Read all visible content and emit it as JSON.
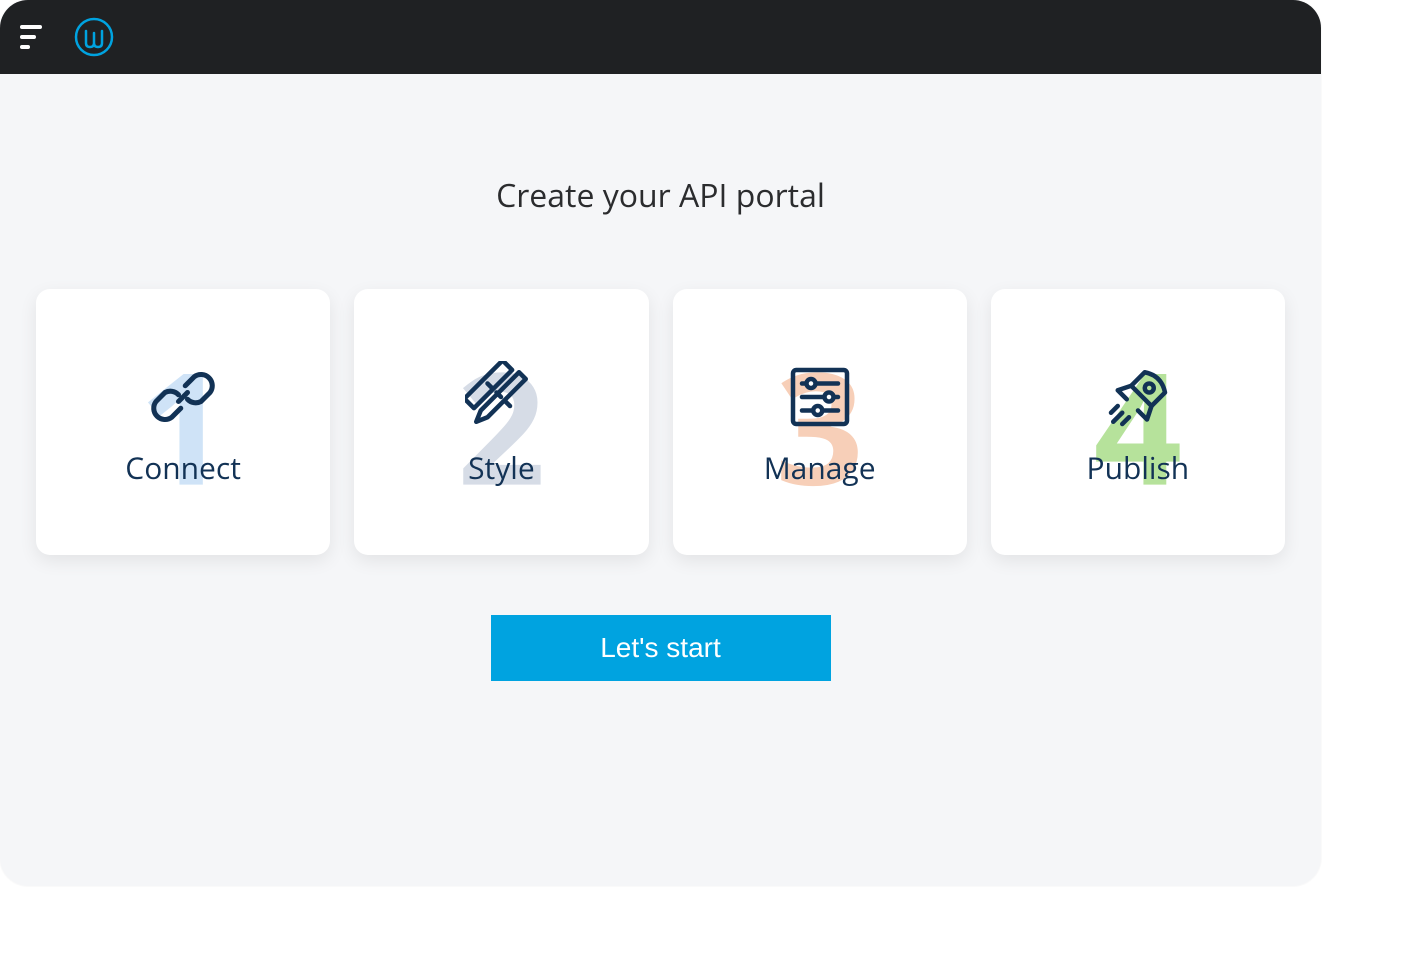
{
  "header": {
    "menu_label": "menu",
    "logo_label": "mulesoft-logo"
  },
  "main": {
    "title": "Create your API portal",
    "cta_label": "Let's start",
    "steps": [
      {
        "number": "1",
        "label": "Connect",
        "number_color": "#cfe3f7",
        "icon": "link-icon"
      },
      {
        "number": "2",
        "label": "Style",
        "number_color": "#d6dce6",
        "icon": "pencil-ruler-icon"
      },
      {
        "number": "3",
        "label": "Manage",
        "number_color": "#f7cfb8",
        "icon": "sliders-panel-icon"
      },
      {
        "number": "4",
        "label": "Publish",
        "number_color": "#b6e29b",
        "icon": "rocket-icon"
      }
    ]
  },
  "colors": {
    "header_bg": "#1f2123",
    "page_bg": "#f5f6f8",
    "card_bg": "#ffffff",
    "button_bg": "#00a3e0",
    "text_primary": "#123255",
    "logo_accent": "#00a3e0"
  }
}
